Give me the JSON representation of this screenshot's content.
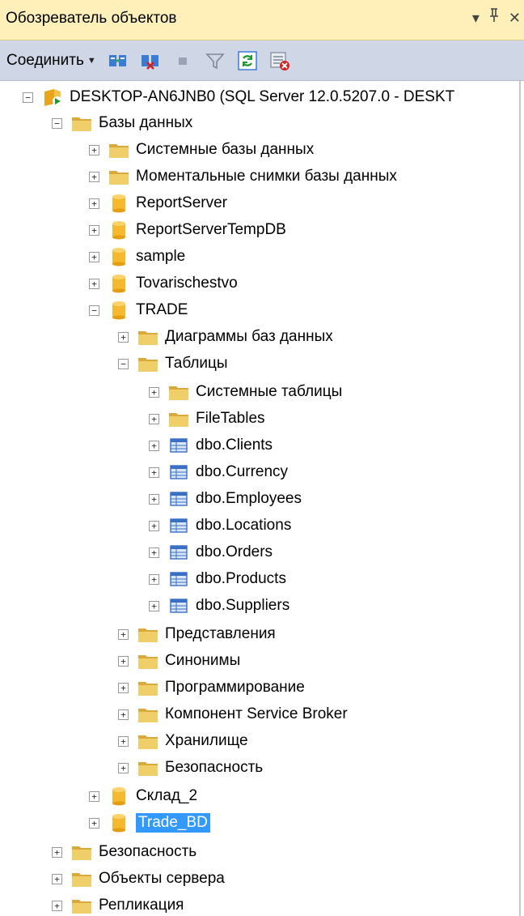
{
  "panel": {
    "title": "Обозреватель объектов",
    "header_icons": [
      "dropdown-icon",
      "pin-icon",
      "close-icon"
    ]
  },
  "toolbar": {
    "connect_label": "Соединить",
    "buttons": [
      "connect-icon",
      "disconnect-icon",
      "stop-icon",
      "filter-icon",
      "refresh-icon",
      "activity-monitor-icon"
    ]
  },
  "tree": {
    "server": "DESKTOP-AN6JNB0 (SQL Server 12.0.5207.0 - DESKT",
    "databases_folder": "Базы данных",
    "system_dbs": "Системные базы данных",
    "snapshots": "Моментальные снимки базы данных",
    "db_reportserver": "ReportServer",
    "db_reportservertemp": "ReportServerTempDB",
    "db_sample": "sample",
    "db_tovarischestvo": "Tovarischestvo",
    "db_trade": "TRADE",
    "trade_diagrams": "Диаграммы баз данных",
    "trade_tables": "Таблицы",
    "tables_system": "Системные таблицы",
    "tables_filetables": "FileTables",
    "t_clients": "dbo.Clients",
    "t_currency": "dbo.Currency",
    "t_employees": "dbo.Employees",
    "t_locations": "dbo.Locations",
    "t_orders": "dbo.Orders",
    "t_products": "dbo.Products",
    "t_suppliers": "dbo.Suppliers",
    "trade_views": "Представления",
    "trade_synonyms": "Синонимы",
    "trade_programmability": "Программирование",
    "trade_servicebroker": "Компонент Service Broker",
    "trade_storage": "Хранилище",
    "trade_security": "Безопасность",
    "db_sklad2": "Склад_2",
    "db_trade_bd": "Trade_BD",
    "server_security": "Безопасность",
    "server_objects": "Объекты сервера",
    "replication": "Репликация"
  },
  "colors": {
    "title_bg": "#ffefb8",
    "toolbar_bg": "#cfd6e5",
    "selection": "#3399ff",
    "folder": "#e8c35a",
    "database": "#f5b82e"
  }
}
